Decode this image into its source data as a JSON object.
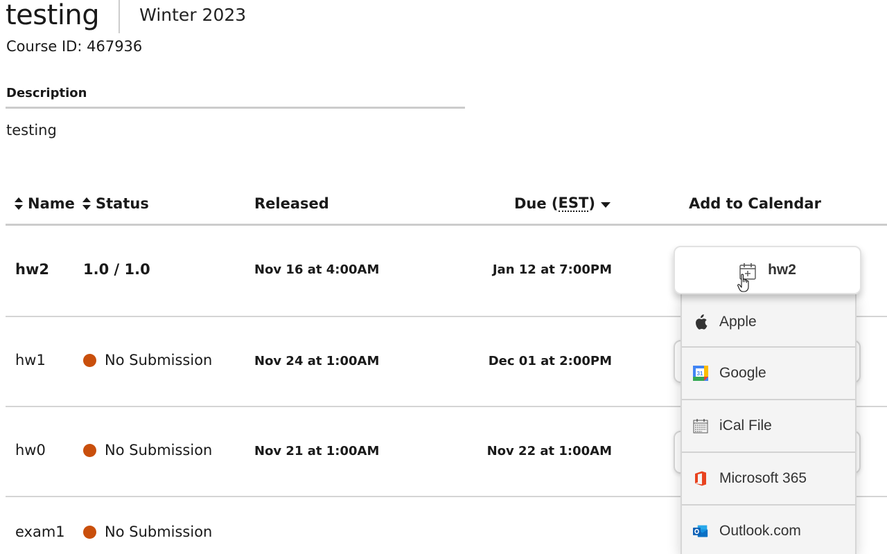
{
  "course": {
    "title": "testing",
    "term": "Winter 2023",
    "course_id_label": "Course ID: 467936",
    "description_heading": "Description",
    "description_text": "testing"
  },
  "table": {
    "headers": {
      "name": "Name",
      "status": "Status",
      "released": "Released",
      "due_prefix": "Due (",
      "due_abbr": "EST",
      "due_suffix": ")",
      "add_to_calendar": "Add to Calendar"
    },
    "rows": [
      {
        "name": "hw2",
        "status": "1.0 / 1.0",
        "status_type": "graded",
        "released": "Nov 16 at 4:00AM",
        "due": "Jan 12 at 7:00PM"
      },
      {
        "name": "hw1",
        "status": "No Submission",
        "status_type": "missing",
        "released": "Nov 24 at 1:00AM",
        "due": "Dec 01 at 2:00PM"
      },
      {
        "name": "hw0",
        "status": "No Submission",
        "status_type": "missing",
        "released": "Nov 21 at 1:00AM",
        "due": "Nov 22 at 1:00AM"
      },
      {
        "name": "exam1",
        "status": "No Submission",
        "status_type": "missing",
        "released": "",
        "due": ""
      }
    ]
  },
  "calendar_popup": {
    "button_label": "hw2",
    "button_icon": "calendar-plus-icon",
    "options": [
      {
        "label": "Apple",
        "icon": "apple-icon"
      },
      {
        "label": "Google",
        "icon": "google-calendar-icon"
      },
      {
        "label": "iCal File",
        "icon": "ical-file-icon"
      },
      {
        "label": "Microsoft 365",
        "icon": "microsoft-365-icon"
      },
      {
        "label": "Outlook.com",
        "icon": "outlook-icon"
      }
    ]
  },
  "colors": {
    "missing_status": "#c94f0c",
    "divider": "#cccccc",
    "dropdown_bg": "#f4f4f4"
  }
}
